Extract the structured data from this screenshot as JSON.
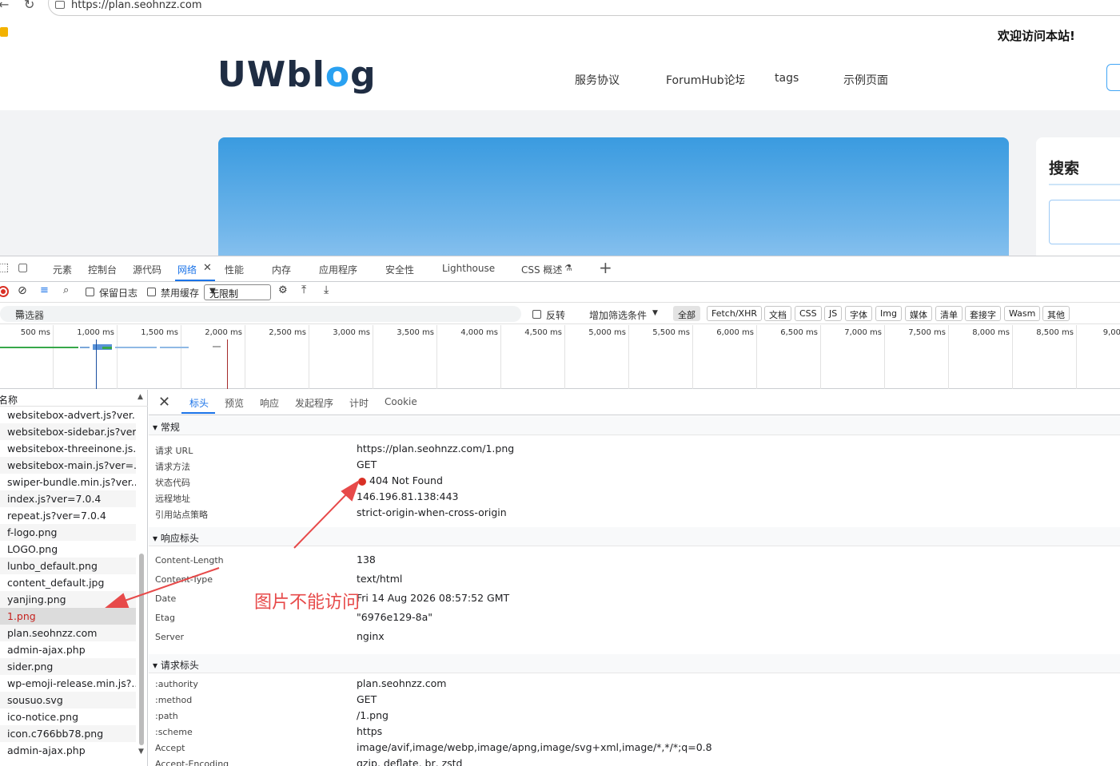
{
  "browser": {
    "url": "https://plan.seohnzz.com"
  },
  "site": {
    "welcome": "欢迎访问本站!",
    "logo_main": "UWbl",
    "logo_o": "o",
    "logo_end": "g",
    "nav": [
      "服务协议",
      "ForumHub论坛",
      "tags",
      "示例页面"
    ],
    "sidebar_title": "搜索"
  },
  "devtools": {
    "tabs": [
      "元素",
      "控制台",
      "源代码",
      "网络",
      "性能",
      "内存",
      "应用程序",
      "安全性",
      "Lighthouse",
      "CSS 概述"
    ],
    "active_tab": "网络",
    "toolbar": {
      "preserve_log": "保留日志",
      "disable_cache": "禁用缓存",
      "throttle": "无限制"
    },
    "filter": {
      "placeholder": "筛选器",
      "invert": "反转",
      "more_filters": "增加筛选条件",
      "types": [
        "全部",
        "Fetch/XHR",
        "文档",
        "CSS",
        "JS",
        "字体",
        "Img",
        "媒体",
        "清单",
        "套接字",
        "Wasm",
        "其他"
      ]
    },
    "timeline_ticks": [
      "500 ms",
      "1,000 ms",
      "1,500 ms",
      "2,000 ms",
      "2,500 ms",
      "3,000 ms",
      "3,500 ms",
      "4,000 ms",
      "4,500 ms",
      "5,000 ms",
      "5,500 ms",
      "6,000 ms",
      "6,500 ms",
      "7,000 ms",
      "7,500 ms",
      "8,000 ms",
      "8,500 ms",
      "9,00"
    ],
    "requests_header": "名称",
    "requests": [
      "websitebox-advert.js?ver...",
      "websitebox-sidebar.js?ver...",
      "websitebox-threeinone.js...",
      "websitebox-main.js?ver=...",
      "swiper-bundle.min.js?ver...",
      "index.js?ver=7.0.4",
      "repeat.js?ver=7.0.4",
      "f-logo.png",
      "LOGO.png",
      "lunbo_default.png",
      "content_default.jpg",
      "yanjing.png",
      "1.png",
      "plan.seohnzz.com",
      "admin-ajax.php",
      "sider.png",
      "wp-emoji-release.min.js?...",
      "sousuo.svg",
      "ico-notice.png",
      "icon.c766bb78.png",
      "admin-ajax.php"
    ],
    "selected_request": "1.png",
    "detail_tabs": [
      "标头",
      "预览",
      "响应",
      "发起程序",
      "计时",
      "Cookie"
    ],
    "general": {
      "title": "常规",
      "rows": [
        {
          "k": "请求 URL",
          "v": "https://plan.seohnzz.com/1.png"
        },
        {
          "k": "请求方法",
          "v": "GET"
        },
        {
          "k": "状态代码",
          "v": "404 Not Found"
        },
        {
          "k": "远程地址",
          "v": "146.196.81.138:443"
        },
        {
          "k": "引用站点策略",
          "v": "strict-origin-when-cross-origin"
        }
      ]
    },
    "response_headers": {
      "title": "响应标头",
      "rows": [
        {
          "k": "Content-Length",
          "v": "138"
        },
        {
          "k": "Content-Type",
          "v": "text/html"
        },
        {
          "k": "Date",
          "v": "Fri 14 Aug 2026 08:57:52 GMT"
        },
        {
          "k": "Etag",
          "v": "\"6976e129-8a\""
        },
        {
          "k": "Server",
          "v": "nginx"
        }
      ]
    },
    "request_headers": {
      "title": "请求标头",
      "rows": [
        {
          "k": ":authority",
          "v": "plan.seohnzz.com"
        },
        {
          "k": ":method",
          "v": "GET"
        },
        {
          "k": ":path",
          "v": "/1.png"
        },
        {
          "k": ":scheme",
          "v": "https"
        },
        {
          "k": "Accept",
          "v": "image/avif,image/webp,image/apng,image/svg+xml,image/*,*/*;q=0.8"
        },
        {
          "k": "Accept-Encoding",
          "v": "gzip, deflate, br, zstd"
        }
      ]
    }
  },
  "annotation": "图片不能访问",
  "colors": {
    "accent": "#1a73e8",
    "error": "#d93025",
    "annotation": "#e74a4a",
    "logo_dark": "#1f2d43",
    "logo_blue": "#2aa1f1"
  }
}
